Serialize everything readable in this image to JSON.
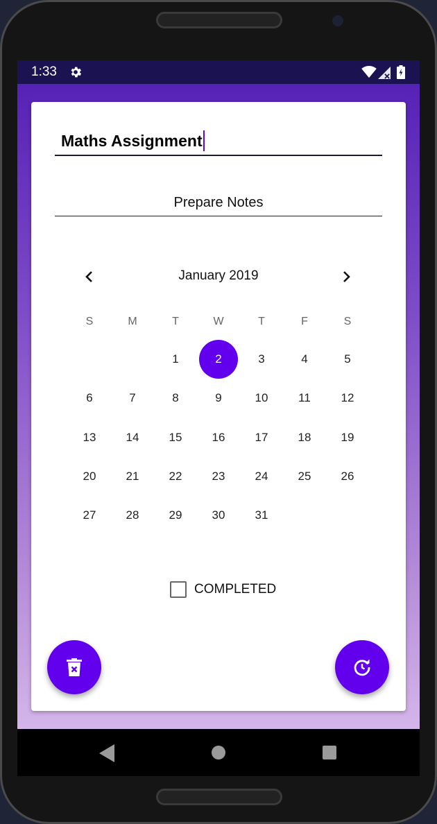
{
  "status_bar": {
    "time": "1:33",
    "icons": [
      "settings-gear-icon",
      "wifi-icon",
      "signal-icon",
      "battery-icon"
    ]
  },
  "task": {
    "title_value": "Maths Assignment",
    "notes_value": "Prepare Notes"
  },
  "calendar": {
    "month_label": "January 2019",
    "weekdays": [
      "S",
      "M",
      "T",
      "W",
      "T",
      "F",
      "S"
    ],
    "weeks": [
      [
        "",
        "",
        "1",
        "2",
        "3",
        "4",
        "5"
      ],
      [
        "6",
        "7",
        "8",
        "9",
        "10",
        "11",
        "12"
      ],
      [
        "13",
        "14",
        "15",
        "16",
        "17",
        "18",
        "19"
      ],
      [
        "20",
        "21",
        "22",
        "23",
        "24",
        "25",
        "26"
      ],
      [
        "27",
        "28",
        "29",
        "30",
        "31",
        "",
        ""
      ]
    ],
    "selected_day": "2"
  },
  "completed": {
    "label": "COMPLETED",
    "checked": false
  },
  "actions": {
    "delete_icon": "delete-icon",
    "reschedule_icon": "reschedule-icon"
  },
  "colors": {
    "accent": "#6200ee",
    "status_bar": "#1b1251",
    "gradient_top": "#5522b6",
    "gradient_bottom": "#d4b6ea"
  }
}
